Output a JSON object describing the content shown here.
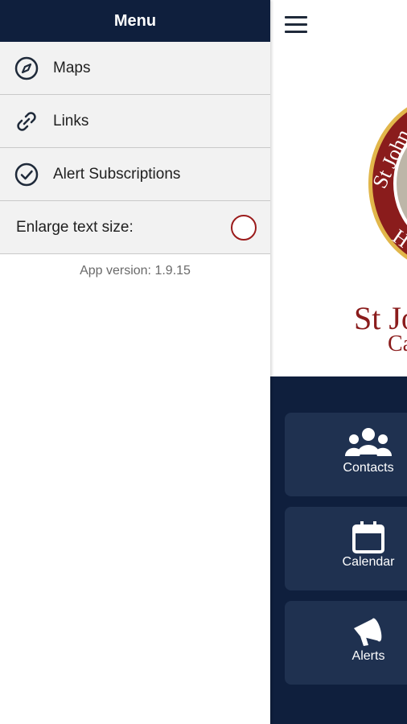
{
  "drawer": {
    "title": "Menu",
    "items": [
      {
        "label": "Maps",
        "icon": "compass-icon"
      },
      {
        "label": "Links",
        "icon": "link-icon"
      },
      {
        "label": "Alert Subscriptions",
        "icon": "check-circle-icon"
      }
    ],
    "enlarge_label": "Enlarge text size:",
    "enlarge_enabled": false,
    "version": "App version: 1.9.15"
  },
  "main": {
    "school_name": "St Jo",
    "school_sub": "Ca",
    "tiles": [
      {
        "label": "Contacts",
        "icon": "people-icon"
      },
      {
        "label": "Calendar",
        "icon": "calendar-icon"
      },
      {
        "label": "Alerts",
        "icon": "megaphone-icon"
      }
    ]
  },
  "colors": {
    "navy": "#0f1f3d",
    "tile": "#1f3150",
    "accent_red": "#8a1c1c"
  }
}
